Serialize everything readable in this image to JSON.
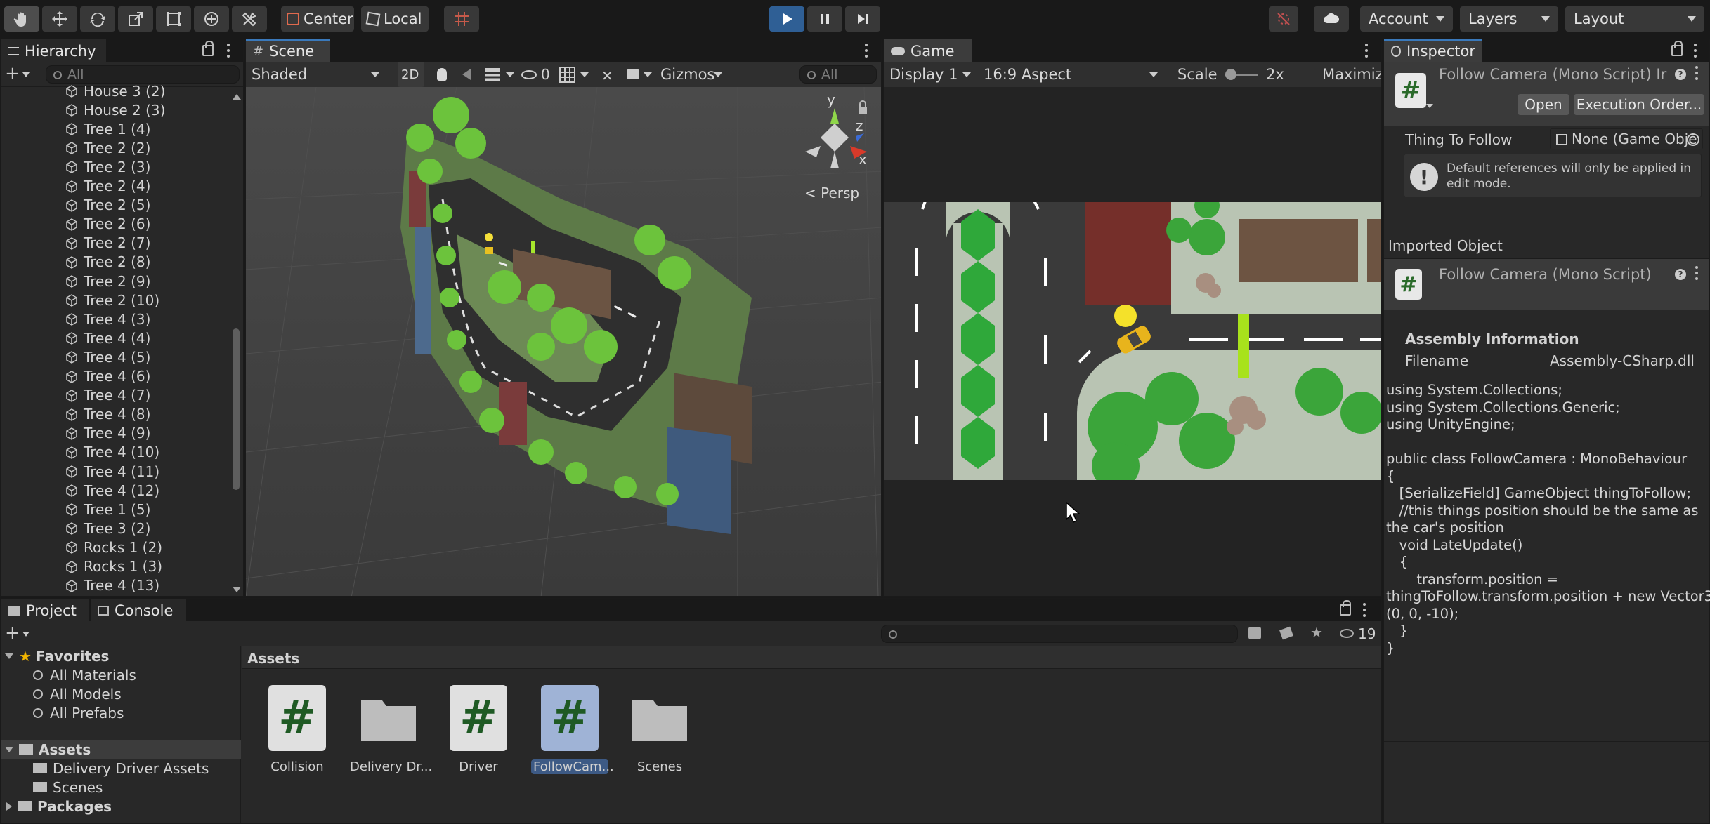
{
  "toolbar": {
    "pivot_label": "Center",
    "space_label": "Local",
    "account_label": "Account",
    "layers_label": "Layers",
    "layout_label": "Layout"
  },
  "hierarchy": {
    "title": "Hierarchy",
    "search_placeholder": "All",
    "items": [
      "House 3 (2)",
      "House 2 (3)",
      "Tree 1 (4)",
      "Tree 2 (2)",
      "Tree 2 (3)",
      "Tree 2 (4)",
      "Tree 2 (5)",
      "Tree 2 (6)",
      "Tree 2 (7)",
      "Tree 2 (8)",
      "Tree 2 (9)",
      "Tree 2 (10)",
      "Tree 4 (3)",
      "Tree 4 (4)",
      "Tree 4 (5)",
      "Tree 4 (6)",
      "Tree 4 (7)",
      "Tree 4 (8)",
      "Tree 4 (9)",
      "Tree 4 (10)",
      "Tree 4 (11)",
      "Tree 4 (12)",
      "Tree 1 (5)",
      "Tree 3 (2)",
      "Rocks 1 (2)",
      "Rocks 1 (3)",
      "Tree 4 (13)"
    ]
  },
  "scene": {
    "title": "Scene",
    "shading": "Shaded",
    "mode_2d": "2D",
    "hidden_count": "0",
    "gizmos": "Gizmos",
    "search_placeholder": "All",
    "persp_label": "Persp",
    "axis_y": "y",
    "axis_z": "z",
    "axis_x": "x"
  },
  "game": {
    "title": "Game",
    "display": "Display 1",
    "aspect": "16:9 Aspect",
    "scale_label": "Scale",
    "scale_value": "2x",
    "maximize": "Maximize"
  },
  "inspector": {
    "title": "Inspector",
    "header_title": "Follow Camera (Mono Script) Ir",
    "open_btn": "Open",
    "exec_btn": "Execution Order...",
    "field_label": "Thing To Follow",
    "field_value": "None (Game Obje",
    "help_text_1": "Default references will only be applied in",
    "help_text_2": "edit mode.",
    "imported_label": "Imported Object",
    "imported_title": "Follow Camera (Mono Script)",
    "assembly_header": "Assembly Information",
    "filename_label": "Filename",
    "filename_value": "Assembly-CSharp.dll",
    "code": "using System.Collections;\nusing System.Collections.Generic;\nusing UnityEngine;\n\npublic class FollowCamera : MonoBehaviour\n{\n   [SerializeField] GameObject thingToFollow;\n   //this things position should be the same as\nthe car's position\n   void LateUpdate()\n   {\n       transform.position =\nthingToFollow.transform.position + new Vector3\n(0, 0, -10);\n   }\n}"
  },
  "project": {
    "tab_project": "Project",
    "tab_console": "Console",
    "hidden_count": "19",
    "favorites_label": "Favorites",
    "favorites": [
      "All Materials",
      "All Models",
      "All Prefabs"
    ],
    "assets_label": "Assets",
    "asset_folders": [
      "Delivery Driver Assets",
      "Scenes"
    ],
    "packages_label": "Packages",
    "breadcrumb": "Assets",
    "files": [
      {
        "name": "Collision",
        "kind": "script"
      },
      {
        "name": "Delivery Dr...",
        "kind": "folder"
      },
      {
        "name": "Driver",
        "kind": "script"
      },
      {
        "name": "FollowCam...",
        "kind": "script"
      },
      {
        "name": "Scenes",
        "kind": "folder"
      }
    ]
  }
}
